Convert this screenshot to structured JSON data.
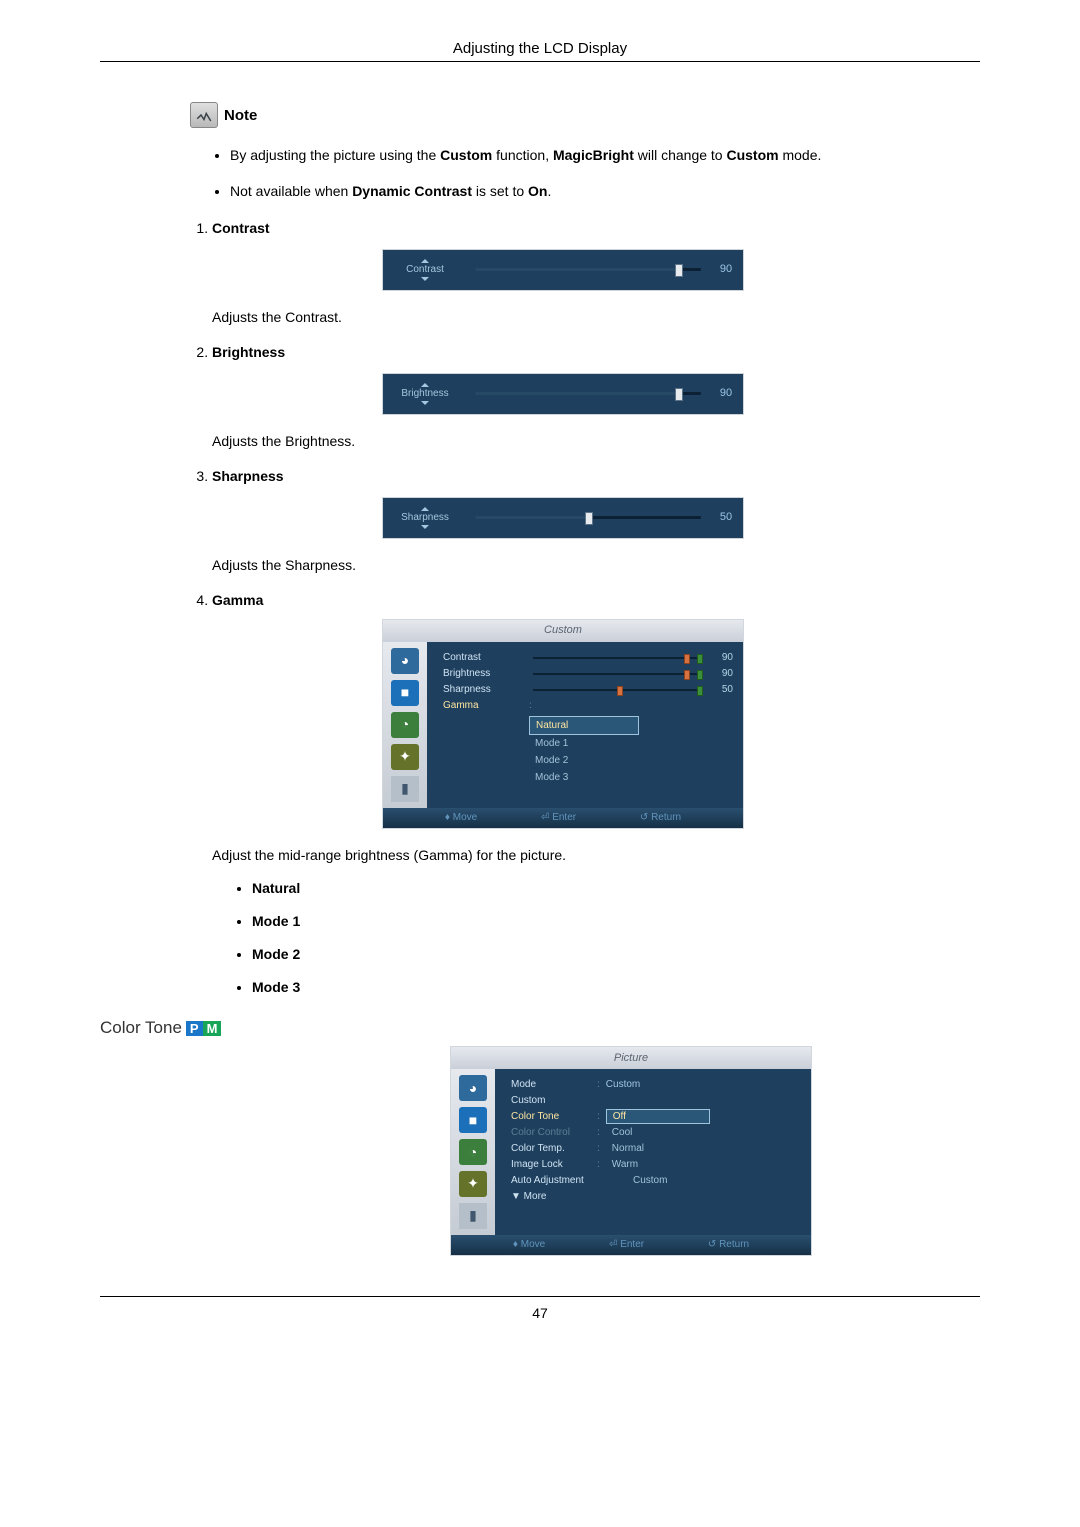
{
  "header": {
    "title": "Adjusting the LCD Display"
  },
  "note": {
    "label": "Note",
    "bullets": [
      {
        "pre": "By adjusting the picture using the ",
        "b1": "Custom",
        "mid1": " function, ",
        "b2": "MagicBright",
        "mid2": " will change to ",
        "b3": "Custom",
        "post": " mode."
      },
      {
        "pre": "Not available when ",
        "b1": "Dynamic Contrast",
        "mid1": " is set to ",
        "b2": "On",
        "post": "."
      }
    ]
  },
  "items": [
    {
      "head": "Contrast",
      "slider": {
        "label": "Contrast",
        "value": 90,
        "percent": 90
      },
      "desc": "Adjusts the Contrast."
    },
    {
      "head": "Brightness",
      "slider": {
        "label": "Brightness",
        "value": 90,
        "percent": 90
      },
      "desc": "Adjusts the Brightness."
    },
    {
      "head": "Sharpness",
      "slider": {
        "label": "Sharpness",
        "value": 50,
        "percent": 50
      },
      "desc": "Adjusts the Sharpness."
    },
    {
      "head": "Gamma",
      "desc": "Adjust the mid-range brightness (Gamma) for the picture.",
      "options": [
        "Natural",
        "Mode 1",
        "Mode 2",
        "Mode 3"
      ]
    }
  ],
  "gamma_menu": {
    "title": "Custom",
    "rows": [
      {
        "label": "Contrast",
        "value": 90,
        "pos": 90
      },
      {
        "label": "Brightness",
        "value": 90,
        "pos": 90
      },
      {
        "label": "Sharpness",
        "value": 50,
        "pos": 50
      }
    ],
    "gamma_label": "Gamma",
    "gamma_options": [
      "Natural",
      "Mode 1",
      "Mode 2",
      "Mode 3"
    ],
    "footer": {
      "move": "Move",
      "enter": "Enter",
      "ret": "Return"
    }
  },
  "color_tone": {
    "heading": "Color Tone",
    "menu_title": "Picture",
    "rows": {
      "mode": {
        "label": "Mode",
        "value": "Custom"
      },
      "custom": {
        "label": "Custom"
      },
      "color_tone": {
        "label": "Color Tone"
      },
      "color_control": {
        "label": "Color Control"
      },
      "color_temp": {
        "label": "Color Temp."
      },
      "image_lock": {
        "label": "Image Lock"
      },
      "auto_adj": {
        "label": "Auto Adjustment"
      },
      "more": {
        "label": "▼ More"
      }
    },
    "options": [
      "Off",
      "Cool",
      "Normal",
      "Warm",
      "Custom"
    ],
    "footer": {
      "move": "Move",
      "enter": "Enter",
      "ret": "Return"
    }
  },
  "page_number": "47"
}
